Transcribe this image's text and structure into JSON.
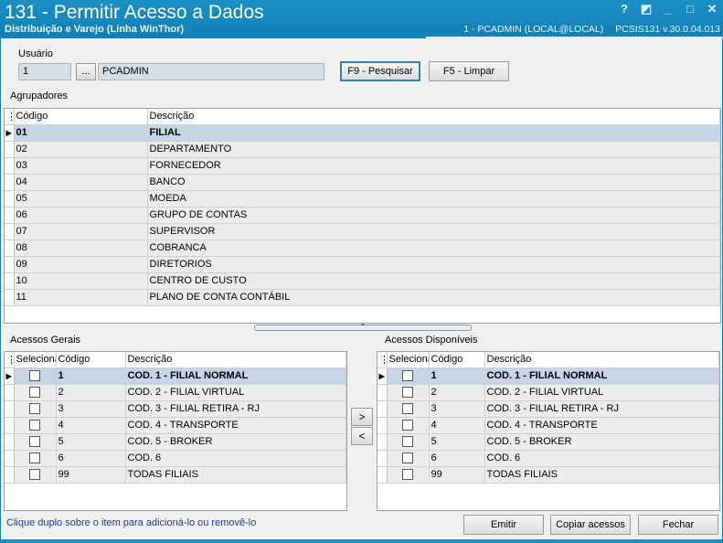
{
  "window": {
    "title": "131 - Permitir Acesso a Dados",
    "subtitle": "Distribuição e Varejo (Linha WinThor)",
    "status_user": "1 - PCADMIN (LOCAL@LOCAL)",
    "status_version": "PCSIS131  v.30.0.04.013",
    "btn_help": "?",
    "btn_restore": "◩",
    "btn_min": "_",
    "btn_max": "□",
    "btn_close": "✕"
  },
  "usuario": {
    "label": "Usuário",
    "code": "1",
    "lookup": "...",
    "name": "PCADMIN",
    "search_button": "F9 - Pesquisar",
    "clear_button": "F5 - Limpar"
  },
  "agrupadores": {
    "label": "Agrupadores",
    "columns": [
      "Código",
      "Descrição"
    ],
    "rows": [
      {
        "code": "01",
        "desc": "FILIAL"
      },
      {
        "code": "02",
        "desc": "DEPARTAMENTO"
      },
      {
        "code": "03",
        "desc": "FORNECEDOR"
      },
      {
        "code": "04",
        "desc": "BANCO"
      },
      {
        "code": "05",
        "desc": "MOEDA"
      },
      {
        "code": "06",
        "desc": "GRUPO DE CONTAS"
      },
      {
        "code": "07",
        "desc": "SUPERVISOR"
      },
      {
        "code": "08",
        "desc": "COBRANCA"
      },
      {
        "code": "09",
        "desc": "DIRETORIOS"
      },
      {
        "code": "10",
        "desc": "CENTRO DE CUSTO"
      },
      {
        "code": "11",
        "desc": "PLANO DE CONTA CONTÁBIL"
      }
    ]
  },
  "splitter": {
    "glyph": "⌃"
  },
  "acessos_gerais": {
    "label": "Acessos Gerais",
    "columns": [
      "Seleciona",
      "Código",
      "Descrição"
    ],
    "rows": [
      {
        "code": "1",
        "desc": "COD. 1 - FILIAL NORMAL"
      },
      {
        "code": "2",
        "desc": "COD. 2 - FILIAL VIRTUAL"
      },
      {
        "code": "3",
        "desc": "COD. 3 - FILIAL RETIRA - RJ"
      },
      {
        "code": "4",
        "desc": "COD. 4 - TRANSPORTE"
      },
      {
        "code": "5",
        "desc": "COD. 5 - BROKER"
      },
      {
        "code": "6",
        "desc": "COD. 6"
      },
      {
        "code": "99",
        "desc": "TODAS FILIAIS"
      }
    ]
  },
  "acessos_disponiveis": {
    "label": "Acessos Disponíveis",
    "columns": [
      "Seleciona",
      "Código",
      "Descrição"
    ],
    "rows": [
      {
        "code": "1",
        "desc": "COD. 1 - FILIAL NORMAL"
      },
      {
        "code": "2",
        "desc": "COD. 2 - FILIAL VIRTUAL"
      },
      {
        "code": "3",
        "desc": "COD. 3 - FILIAL RETIRA - RJ"
      },
      {
        "code": "4",
        "desc": "COD. 4 - TRANSPORTE"
      },
      {
        "code": "5",
        "desc": "COD. 5 - BROKER"
      },
      {
        "code": "6",
        "desc": "COD. 6"
      },
      {
        "code": "99",
        "desc": "TODAS FILIAIS"
      }
    ]
  },
  "move": {
    "right": ">",
    "left": "<"
  },
  "footer": {
    "hint": "Clique duplo sobre o item para adicioná-lo ou removê-lo",
    "emitir": "Emitir",
    "copiar": "Copiar acessos",
    "fechar": "Fechar"
  }
}
